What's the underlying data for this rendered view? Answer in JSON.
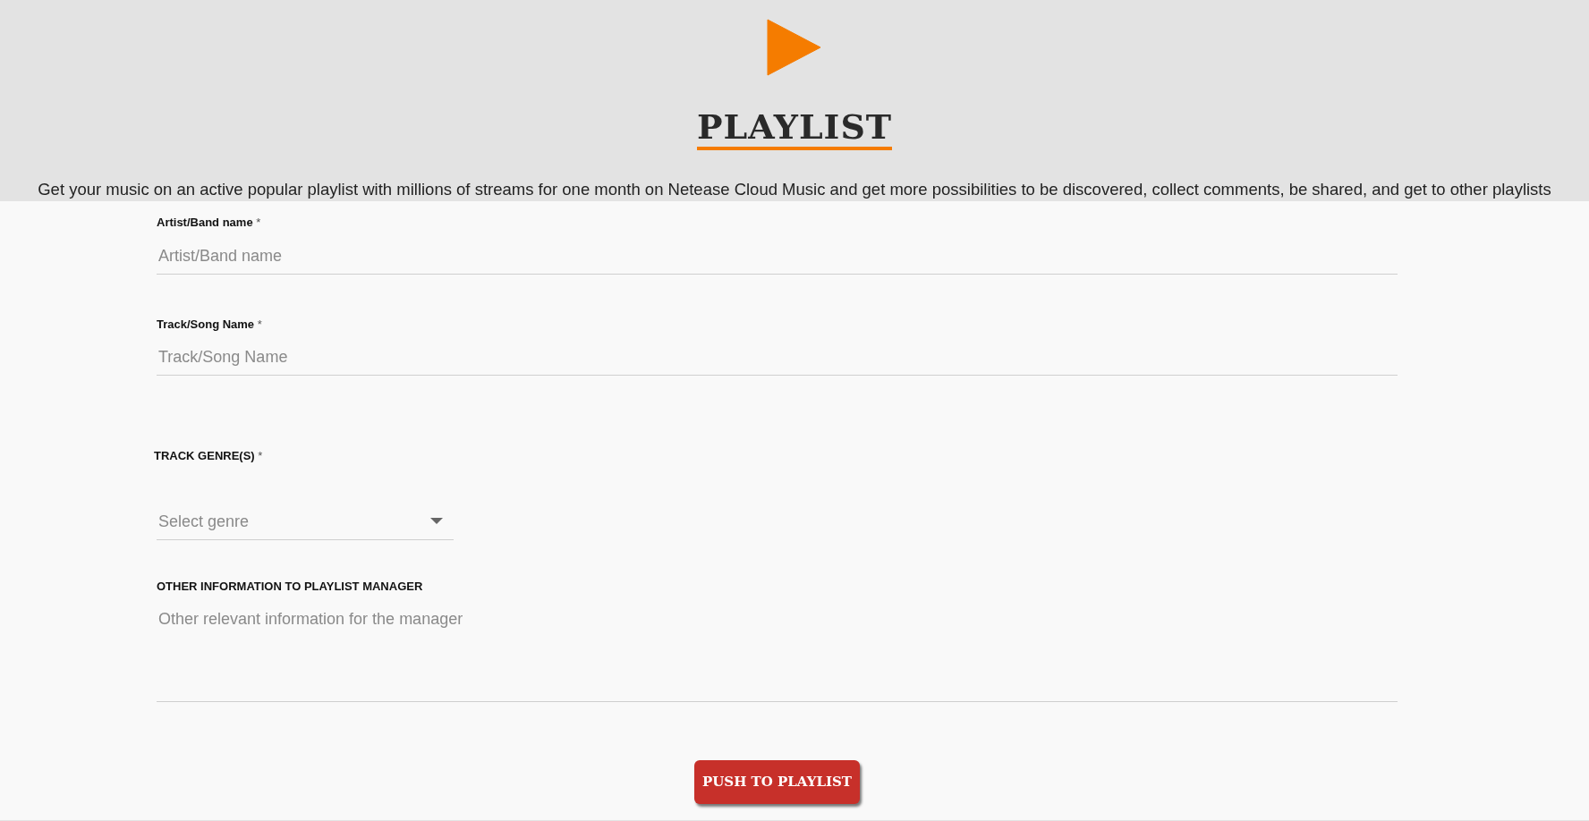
{
  "header": {
    "title": "PLAYLIST",
    "description": "Get your music on an active popular playlist with millions of streams for one month on Netease Cloud Music and get more possibilities to be discovered, collect comments, be shared, and get to other playlists"
  },
  "fields": [
    {
      "kind": "text",
      "label": "Artist/Band name",
      "required_mark": "*",
      "placeholder": "Artist/Band name"
    },
    {
      "kind": "text",
      "label": "Track/Song Name",
      "required_mark": "*",
      "placeholder": "Track/Song Name"
    },
    {
      "kind": "select",
      "label": "TRACK GENRE(S)",
      "required_mark": "*",
      "placeholder": "Select genre"
    },
    {
      "kind": "textarea",
      "label": "OTHER INFORMATION TO PLAYLIST MANAGER",
      "placeholder": "Other relevant information for the manager"
    }
  ],
  "submit": {
    "label": "PUSH TO PLAYLIST"
  }
}
